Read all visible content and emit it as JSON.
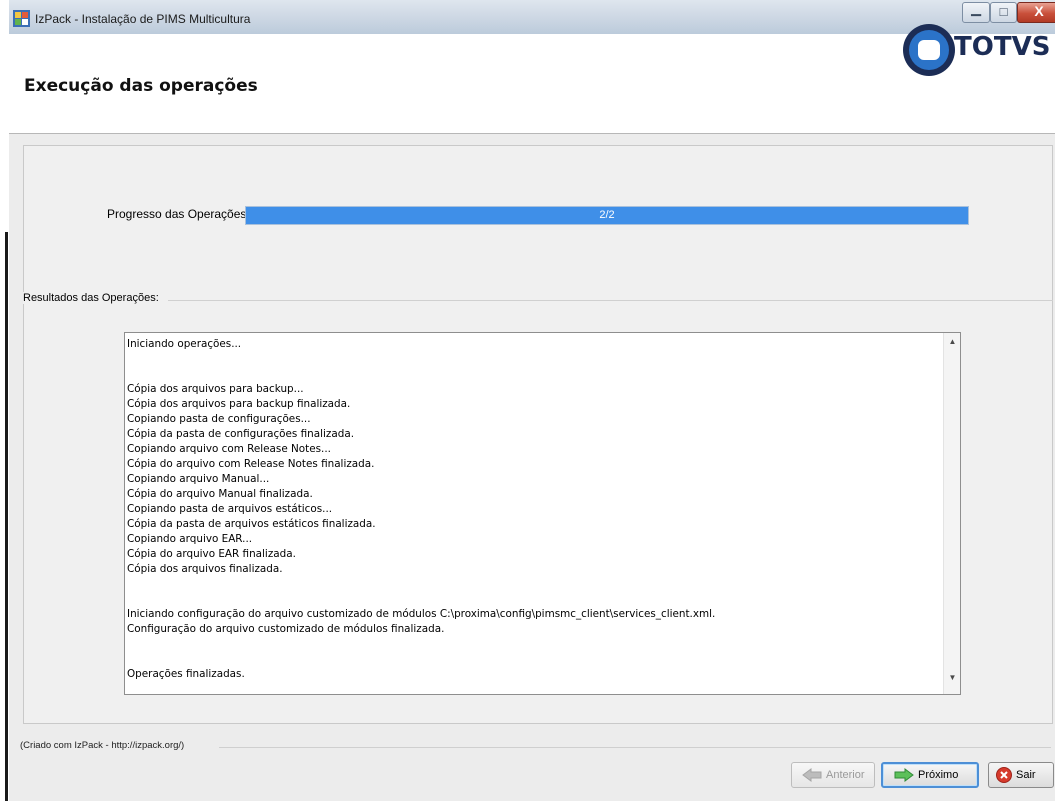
{
  "window": {
    "title": "IzPack - Instalação de PIMS Multicultura",
    "controls": {
      "minimize": "▁",
      "maximize": "□",
      "close": "X"
    }
  },
  "header": {
    "heading": "Execução das operações",
    "logo_text": "TOTVS",
    "logo_icon": "totvs-logo-icon"
  },
  "progress": {
    "label": "Progresso das Operações:",
    "text": "2/2",
    "value": 1.0,
    "color": "#3f8fe8"
  },
  "results": {
    "group_label": "Resultados das Operações:",
    "lines": [
      "Iniciando operações...",
      "",
      "",
      "Cópia dos arquivos para backup...",
      "Cópia dos arquivos para backup finalizada.",
      "Copiando pasta de configurações...",
      "Cópia da pasta de configurações finalizada.",
      "Copiando arquivo com Release Notes...",
      "Cópia do arquivo com Release Notes finalizada.",
      "Copiando arquivo Manual...",
      "Cópia do arquivo Manual finalizada.",
      "Copiando pasta de arquivos estáticos...",
      "Cópia da pasta de arquivos estáticos finalizada.",
      "Copiando arquivo EAR...",
      "Cópia do arquivo EAR finalizada.",
      "Cópia dos arquivos finalizada.",
      "",
      "",
      "Iniciando configuração do arquivo customizado de módulos C:\\proxima\\config\\pimsmc_client\\services_client.xml.",
      "Configuração do arquivo customizado de módulos finalizada.",
      "",
      "",
      "Operações finalizadas."
    ]
  },
  "footer": {
    "credit": "(Criado com IzPack - http://izpack.org/)",
    "buttons": {
      "previous": "Anterior",
      "next": "Próximo",
      "quit": "Sair"
    }
  }
}
